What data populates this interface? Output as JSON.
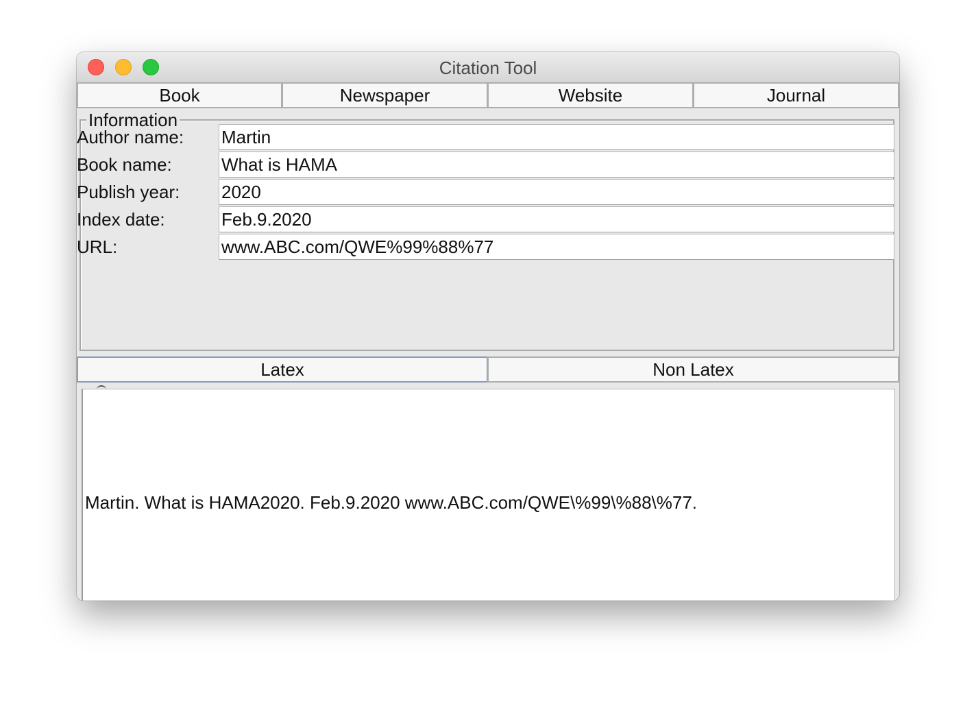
{
  "window": {
    "title": "Citation Tool"
  },
  "source_tabs": [
    {
      "label": "Book"
    },
    {
      "label": "Newspaper"
    },
    {
      "label": "Website"
    },
    {
      "label": "Journal"
    }
  ],
  "information": {
    "legend": "Information",
    "fields": [
      {
        "label": "Author name:",
        "value": "Martin"
      },
      {
        "label": "Book name:",
        "value": "What is HAMA"
      },
      {
        "label": "Publish year:",
        "value": "2020"
      },
      {
        "label": "Index date:",
        "value": "Feb.9.2020"
      },
      {
        "label": "URL:",
        "value": "www.ABC.com/QWE%99%88%77"
      }
    ]
  },
  "format_tabs": [
    {
      "label": "Latex",
      "selected": true
    },
    {
      "label": "Non Latex",
      "selected": false
    }
  ],
  "output": {
    "text": "Martin. What is HAMA2020. Feb.9.2020 www.ABC.com/QWE\\%99\\%88\\%77."
  }
}
